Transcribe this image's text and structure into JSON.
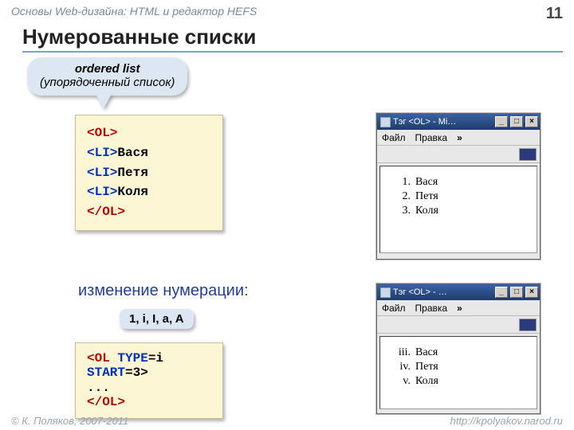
{
  "header": {
    "course": "Основы Web-дизайна: HTML и редактор HEFS",
    "page_number": "11"
  },
  "title": "Нумерованные списки",
  "callout": {
    "line1": "ordered list",
    "line2": "(упорядоченный список)"
  },
  "code1": {
    "l1a": "<OL>",
    "l2a": "<LI>",
    "l2b": "Вася",
    "l3a": "<LI>",
    "l3b": "Петя",
    "l4a": "<LI>",
    "l4b": "Коля",
    "l5a": "</OL>"
  },
  "section2_label": "изменение нумерации:",
  "badge": "1, i, I, a, A",
  "code2": {
    "l1a": "<OL ",
    "l1b": "TYPE",
    "l1c": "=i",
    "l2a": "START",
    "l2b": "=3>",
    "l3": "...",
    "l4": "</OL>"
  },
  "win_common": {
    "menu_file": "Файл",
    "menu_edit": "Правка",
    "more": "»",
    "btn_min": "_",
    "btn_max": "□",
    "btn_close": "×"
  },
  "win1": {
    "title": "Тэг <OL> - Mi…",
    "items": [
      {
        "n": "1.",
        "t": "Вася"
      },
      {
        "n": "2.",
        "t": "Петя"
      },
      {
        "n": "3.",
        "t": "Коля"
      }
    ]
  },
  "win2": {
    "title": "Тэг <OL> - …",
    "items": [
      {
        "n": "iii.",
        "t": "Вася"
      },
      {
        "n": "iv.",
        "t": "Петя"
      },
      {
        "n": "v.",
        "t": "Коля"
      }
    ]
  },
  "footer": {
    "copyright": "© К. Поляков, 2007-2011",
    "url": "http://kpolyakov.narod.ru"
  }
}
